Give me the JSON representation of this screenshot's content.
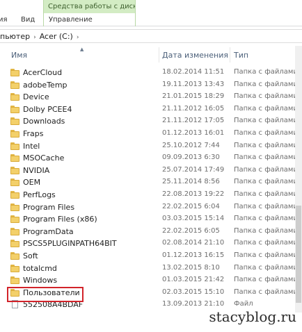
{
  "ribbon": {
    "context_header": "Средства работы с дисками",
    "tabs": [
      {
        "label": "ия"
      },
      {
        "label": "Вид"
      },
      {
        "label": "Управление"
      }
    ]
  },
  "address": {
    "segments": [
      "пьютер",
      "Acer (C:)"
    ]
  },
  "columns": {
    "name": "Имя",
    "date": "Дата изменения",
    "type": "Тип"
  },
  "rows": [
    {
      "name": "AcerCloud",
      "date": "18.02.2014 11:51",
      "type": "Папка с файлами",
      "icon": "folder-icon"
    },
    {
      "name": "adobeTemp",
      "date": "19.11.2013 13:43",
      "type": "Папка с файлами",
      "icon": "folder-icon"
    },
    {
      "name": "Device",
      "date": "21.01.2015 18:29",
      "type": "Папка с файлами",
      "icon": "folder-icon"
    },
    {
      "name": "Dolby PCEE4",
      "date": "21.11.2012 16:05",
      "type": "Папка с файлами",
      "icon": "folder-icon"
    },
    {
      "name": "Downloads",
      "date": "21.11.2012 17:05",
      "type": "Папка с файлами",
      "icon": "folder-icon"
    },
    {
      "name": "Fraps",
      "date": "01.12.2013 16:01",
      "type": "Папка с файлами",
      "icon": "folder-icon"
    },
    {
      "name": "Intel",
      "date": "25.10.2012 7:44",
      "type": "Папка с файлами",
      "icon": "folder-icon"
    },
    {
      "name": "MSOCache",
      "date": "09.09.2013 6:30",
      "type": "Папка с файлами",
      "icon": "folder-icon"
    },
    {
      "name": "NVIDIA",
      "date": "25.07.2014 17:49",
      "type": "Папка с файлами",
      "icon": "folder-icon"
    },
    {
      "name": "OEM",
      "date": "25.11.2014 8:56",
      "type": "Папка с файлами",
      "icon": "folder-icon"
    },
    {
      "name": "PerfLogs",
      "date": "22.08.2013 19:22",
      "type": "Папка с файлами",
      "icon": "folder-icon"
    },
    {
      "name": "Program Files",
      "date": "22.02.2015 6:04",
      "type": "Папка с файлами",
      "icon": "folder-icon"
    },
    {
      "name": "Program Files (x86)",
      "date": "03.03.2015 15:14",
      "type": "Папка с файлами",
      "icon": "folder-icon"
    },
    {
      "name": "ProgramData",
      "date": "22.02.2015 6:05",
      "type": "Папка с файлами",
      "icon": "folder-icon"
    },
    {
      "name": "PSCS5PLUGINPATH64BIT",
      "date": "02.08.2014 21:10",
      "type": "Папка с файлами",
      "icon": "folder-icon"
    },
    {
      "name": "Soft",
      "date": "01.12.2013 16:15",
      "type": "Папка с файлами",
      "icon": "folder-icon"
    },
    {
      "name": "totalcmd",
      "date": "13.02.2015 8:10",
      "type": "Папка с файлами",
      "icon": "folder-icon"
    },
    {
      "name": "Windows",
      "date": "01.03.2015 21:42",
      "type": "Папка с файлами",
      "icon": "folder-icon"
    },
    {
      "name": "Пользователи",
      "date": "02.03.2015 15:10",
      "type": "Папка с файлами",
      "icon": "folder-icon"
    },
    {
      "name": "552508A4BDAF",
      "date": "13.09.2013 21:10",
      "type": "Файл",
      "icon": "file-icon"
    }
  ],
  "watermark": "stacyblog.ru"
}
